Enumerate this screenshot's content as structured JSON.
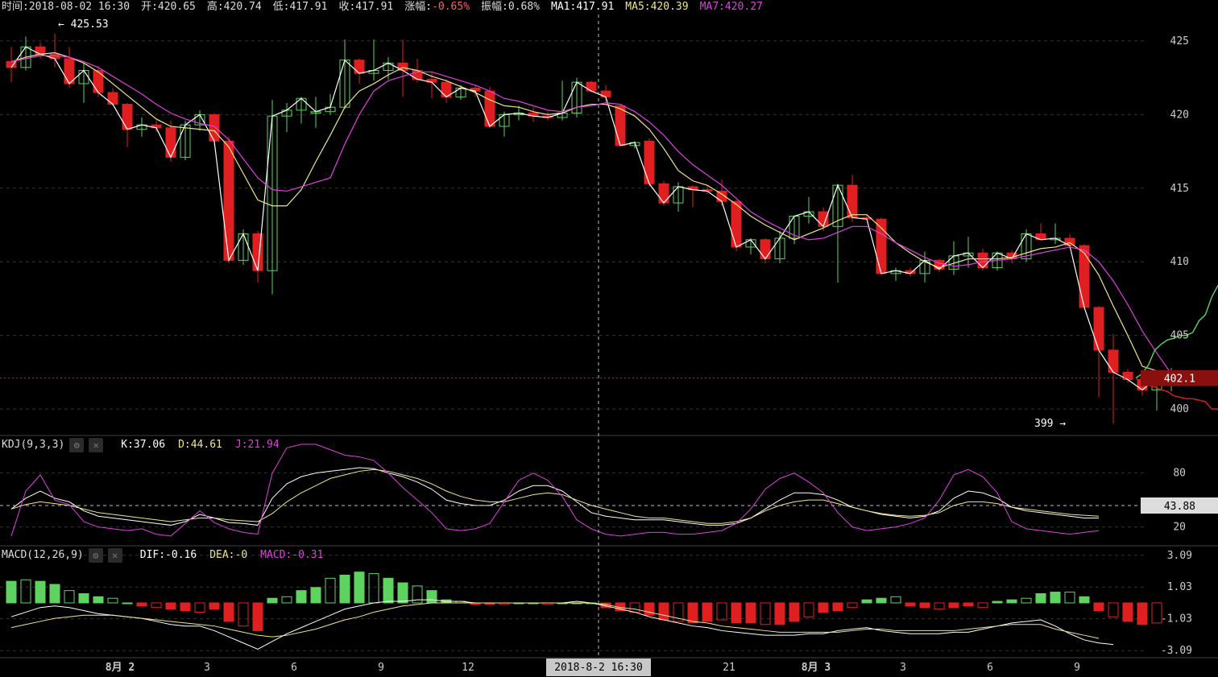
{
  "header": {
    "time_label": "时间:2018-08-02 16:30",
    "open_label": "开:420.65",
    "high_label": "高:420.74",
    "low_label": "低:417.91",
    "close_label": "收:417.91",
    "change_prefix": "涨幅:",
    "change_value": "-0.65%",
    "amplitude_label": "振幅:0.68%",
    "ma1_label": "MA1:417.91",
    "ma5_label": "MA5:420.39",
    "ma7_label": "MA7:420.27"
  },
  "kdj": {
    "title": "KDJ(9,3,3)",
    "k_label": "K:37.06",
    "d_label": "D:44.61",
    "j_label": "J:21.94"
  },
  "macd": {
    "title": "MACD(12,26,9)",
    "dif_label": "DIF:-0.16",
    "dea_label": "DEA:-0",
    "macd_label": "MACD:-0.31"
  },
  "colors": {
    "up": "#5fd35f",
    "down": "#e02020",
    "ma1": "#ffffff",
    "ma5": "#f0e68c",
    "ma7": "#e040e0",
    "change_text": "#ff6060",
    "grid": "#333333",
    "axis_text": "#cccccc"
  },
  "icons": {
    "settings": "gear-icon",
    "close": "close-icon"
  },
  "chart_data": {
    "type": "candlestick",
    "price_axis": {
      "ticks": [
        425,
        420,
        415,
        410,
        405,
        400
      ],
      "ylim": [
        398.2,
        426.8
      ]
    },
    "x_labels": [
      {
        "i": 7.5,
        "label": "8月 2",
        "bold": true
      },
      {
        "i": 13.5,
        "label": "3"
      },
      {
        "i": 19.5,
        "label": "6"
      },
      {
        "i": 25.5,
        "label": "9"
      },
      {
        "i": 31.5,
        "label": "12"
      },
      {
        "i": 49.5,
        "label": "21"
      },
      {
        "i": 55.5,
        "label": "8月 3",
        "bold": true
      },
      {
        "i": 61.5,
        "label": "3"
      },
      {
        "i": 67.5,
        "label": "6"
      },
      {
        "i": 73.5,
        "label": "9"
      }
    ],
    "crosshair": {
      "index": 40.5,
      "price": 402.1,
      "price_label": "402.1",
      "time_label": "2018-8-2 16:30"
    },
    "annotations": {
      "high_label": "← 425.53",
      "low_label": "399 →"
    },
    "candles": [
      {
        "o": 423.6,
        "h": 424.6,
        "l": 422.2,
        "c": 423.2
      },
      {
        "o": 423.2,
        "h": 425.3,
        "l": 423.0,
        "c": 424.6
      },
      {
        "o": 424.6,
        "h": 424.9,
        "l": 423.8,
        "c": 424.1
      },
      {
        "o": 424.1,
        "h": 425.5,
        "l": 423.2,
        "c": 423.8
      },
      {
        "o": 423.8,
        "h": 424.6,
        "l": 421.8,
        "c": 422.1
      },
      {
        "o": 422.1,
        "h": 423.5,
        "l": 420.8,
        "c": 423.0
      },
      {
        "o": 423.0,
        "h": 423.3,
        "l": 421.2,
        "c": 421.5
      },
      {
        "o": 421.5,
        "h": 421.8,
        "l": 420.6,
        "c": 420.7
      },
      {
        "o": 420.7,
        "h": 420.8,
        "l": 417.8,
        "c": 419.0
      },
      {
        "o": 419.0,
        "h": 419.8,
        "l": 418.5,
        "c": 419.3
      },
      {
        "o": 419.3,
        "h": 419.6,
        "l": 418.8,
        "c": 419.1
      },
      {
        "o": 419.1,
        "h": 419.6,
        "l": 416.8,
        "c": 417.1
      },
      {
        "o": 417.1,
        "h": 419.6,
        "l": 416.9,
        "c": 419.3
      },
      {
        "o": 419.3,
        "h": 420.3,
        "l": 418.9,
        "c": 420.0
      },
      {
        "o": 420.0,
        "h": 420.1,
        "l": 417.9,
        "c": 418.2
      },
      {
        "o": 418.2,
        "h": 418.5,
        "l": 409.9,
        "c": 410.1
      },
      {
        "o": 410.1,
        "h": 412.2,
        "l": 409.8,
        "c": 411.9
      },
      {
        "o": 411.9,
        "h": 412.1,
        "l": 408.6,
        "c": 409.4
      },
      {
        "o": 409.4,
        "h": 421.0,
        "l": 407.8,
        "c": 419.9
      },
      {
        "o": 419.9,
        "h": 420.8,
        "l": 418.8,
        "c": 420.3
      },
      {
        "o": 420.3,
        "h": 421.2,
        "l": 419.4,
        "c": 421.1
      },
      {
        "o": 420.1,
        "h": 421.2,
        "l": 419.1,
        "c": 420.2
      },
      {
        "o": 420.2,
        "h": 421.4,
        "l": 420.0,
        "c": 420.5
      },
      {
        "o": 420.5,
        "h": 425.1,
        "l": 420.4,
        "c": 423.7
      },
      {
        "o": 423.7,
        "h": 423.8,
        "l": 422.1,
        "c": 422.8
      },
      {
        "o": 422.8,
        "h": 425.1,
        "l": 422.3,
        "c": 423.0
      },
      {
        "o": 423.0,
        "h": 423.9,
        "l": 422.4,
        "c": 423.5
      },
      {
        "o": 423.5,
        "h": 425.1,
        "l": 421.2,
        "c": 423.0
      },
      {
        "o": 423.0,
        "h": 423.8,
        "l": 422.2,
        "c": 422.4
      },
      {
        "o": 422.4,
        "h": 422.9,
        "l": 421.1,
        "c": 422.2
      },
      {
        "o": 422.2,
        "h": 422.4,
        "l": 420.8,
        "c": 421.2
      },
      {
        "o": 421.2,
        "h": 422.0,
        "l": 421.0,
        "c": 421.8
      },
      {
        "o": 421.8,
        "h": 422.0,
        "l": 421.2,
        "c": 421.6
      },
      {
        "o": 421.6,
        "h": 421.9,
        "l": 419.1,
        "c": 419.2
      },
      {
        "o": 419.2,
        "h": 420.2,
        "l": 418.5,
        "c": 420.0
      },
      {
        "o": 420.0,
        "h": 420.6,
        "l": 419.6,
        "c": 420.1
      },
      {
        "o": 420.1,
        "h": 420.5,
        "l": 419.5,
        "c": 419.9
      },
      {
        "o": 419.9,
        "h": 420.2,
        "l": 419.6,
        "c": 419.8
      },
      {
        "o": 419.8,
        "h": 422.3,
        "l": 419.6,
        "c": 420.1
      },
      {
        "o": 420.1,
        "h": 422.5,
        "l": 419.8,
        "c": 422.2
      },
      {
        "o": 422.2,
        "h": 422.3,
        "l": 421.5,
        "c": 421.6
      },
      {
        "o": 421.6,
        "h": 422.0,
        "l": 420.6,
        "c": 421.2
      },
      {
        "o": 420.6,
        "h": 420.7,
        "l": 417.9,
        "c": 417.9
      },
      {
        "o": 417.9,
        "h": 418.2,
        "l": 417.7,
        "c": 418.1
      },
      {
        "o": 418.2,
        "h": 418.4,
        "l": 415.1,
        "c": 415.3
      },
      {
        "o": 415.3,
        "h": 415.5,
        "l": 413.8,
        "c": 414.0
      },
      {
        "o": 414.0,
        "h": 415.4,
        "l": 413.4,
        "c": 415.1
      },
      {
        "o": 415.1,
        "h": 415.2,
        "l": 413.7,
        "c": 414.9
      },
      {
        "o": 414.9,
        "h": 415.2,
        "l": 414.6,
        "c": 414.8
      },
      {
        "o": 414.8,
        "h": 415.6,
        "l": 413.8,
        "c": 414.1
      },
      {
        "o": 414.1,
        "h": 414.2,
        "l": 410.7,
        "c": 411.0
      },
      {
        "o": 411.0,
        "h": 411.6,
        "l": 410.5,
        "c": 411.5
      },
      {
        "o": 411.5,
        "h": 411.6,
        "l": 409.9,
        "c": 410.2
      },
      {
        "o": 410.2,
        "h": 412.1,
        "l": 409.9,
        "c": 411.6
      },
      {
        "o": 411.6,
        "h": 413.1,
        "l": 411.2,
        "c": 413.1
      },
      {
        "o": 413.1,
        "h": 414.4,
        "l": 412.6,
        "c": 413.4
      },
      {
        "o": 413.4,
        "h": 413.7,
        "l": 412.1,
        "c": 412.4
      },
      {
        "o": 412.4,
        "h": 415.3,
        "l": 408.6,
        "c": 415.2
      },
      {
        "o": 415.2,
        "h": 415.9,
        "l": 412.7,
        "c": 413.0
      },
      {
        "o": 413.0,
        "h": 413.2,
        "l": 412.9,
        "c": 412.9
      },
      {
        "o": 412.9,
        "h": 413.0,
        "l": 409.1,
        "c": 409.2
      },
      {
        "o": 409.2,
        "h": 409.6,
        "l": 408.7,
        "c": 409.4
      },
      {
        "o": 409.4,
        "h": 409.6,
        "l": 409.0,
        "c": 409.2
      },
      {
        "o": 409.2,
        "h": 410.7,
        "l": 408.6,
        "c": 410.1
      },
      {
        "o": 410.1,
        "h": 410.2,
        "l": 409.3,
        "c": 409.5
      },
      {
        "o": 409.5,
        "h": 411.4,
        "l": 409.1,
        "c": 410.4
      },
      {
        "o": 410.4,
        "h": 411.7,
        "l": 409.6,
        "c": 410.6
      },
      {
        "o": 410.6,
        "h": 410.9,
        "l": 409.4,
        "c": 409.6
      },
      {
        "o": 409.6,
        "h": 410.7,
        "l": 409.4,
        "c": 410.6
      },
      {
        "o": 410.6,
        "h": 410.8,
        "l": 409.9,
        "c": 410.2
      },
      {
        "o": 410.2,
        "h": 412.2,
        "l": 410.0,
        "c": 411.9
      },
      {
        "o": 411.9,
        "h": 412.6,
        "l": 411.6,
        "c": 411.5
      },
      {
        "o": 411.5,
        "h": 412.6,
        "l": 411.2,
        "c": 411.6
      },
      {
        "o": 411.6,
        "h": 411.9,
        "l": 410.9,
        "c": 411.1
      },
      {
        "o": 411.1,
        "h": 411.2,
        "l": 406.8,
        "c": 406.9
      },
      {
        "o": 406.9,
        "h": 407.0,
        "l": 400.8,
        "c": 404.0
      },
      {
        "o": 404.0,
        "h": 405.1,
        "l": 399.0,
        "c": 402.5
      },
      {
        "o": 402.5,
        "h": 402.7,
        "l": 401.8,
        "c": 402.0
      },
      {
        "o": 402.0,
        "h": 402.2,
        "l": 400.9,
        "c": 401.3
      },
      {
        "o": 401.3,
        "h": 402.6,
        "l": 399.9,
        "c": 402.1
      },
      {
        "o": 402.1,
        "h": 402.8,
        "l": 401.2,
        "c": 402.1
      }
    ],
    "ma5": [
      423.6,
      423.9,
      424.1,
      424.2,
      423.9,
      423.5,
      422.9,
      422.1,
      421.3,
      420.5,
      419.7,
      419.2,
      419.1,
      419.0,
      418.9,
      417.8,
      416.0,
      414.2,
      413.8,
      413.8,
      414.9,
      416.8,
      418.6,
      420.5,
      421.6,
      422.1,
      422.7,
      423.2,
      423.0,
      422.6,
      422.3,
      421.9,
      421.5,
      421.0,
      420.6,
      420.5,
      420.2,
      420.0,
      420.1,
      420.5,
      420.7,
      420.7,
      420.4,
      419.9,
      419.0,
      417.7,
      416.2,
      415.5,
      415.2,
      414.6,
      413.9,
      413.1,
      412.5,
      412.0,
      411.5,
      411.9,
      412.3,
      412.8,
      413.2,
      413.2,
      412.3,
      411.3,
      410.6,
      410.0,
      409.6,
      409.9,
      410.2,
      410.2,
      410.2,
      410.3,
      410.6,
      410.9,
      411.0,
      411.3,
      410.6,
      409.1,
      407.0,
      405.0,
      402.9,
      402.6,
      402.1
    ],
    "ma7": [
      423.6,
      423.8,
      424.0,
      424.0,
      423.9,
      423.6,
      423.2,
      422.6,
      422.0,
      421.4,
      420.7,
      420.1,
      419.7,
      419.4,
      419.2,
      418.3,
      417.0,
      415.7,
      414.9,
      414.8,
      415.1,
      415.4,
      415.7,
      418.0,
      420.0,
      421.6,
      422.3,
      422.6,
      422.9,
      422.9,
      422.6,
      422.3,
      422.0,
      421.6,
      421.1,
      420.9,
      420.6,
      420.3,
      420.2,
      420.5,
      420.6,
      420.8,
      420.7,
      420.2,
      419.5,
      418.6,
      417.5,
      416.6,
      415.9,
      415.2,
      414.3,
      413.4,
      412.8,
      412.3,
      411.8,
      411.5,
      411.6,
      412.0,
      412.4,
      412.4,
      411.9,
      411.3,
      410.8,
      410.3,
      409.9,
      409.7,
      409.8,
      410.0,
      410.1,
      410.2,
      410.4,
      410.6,
      410.8,
      411.0,
      410.8,
      410.0,
      408.7,
      407.1,
      405.3,
      403.8,
      402.4
    ],
    "kdj": {
      "ticks": [
        80,
        20
      ],
      "ylim": [
        0,
        120
      ],
      "crosshair_value": 43.88,
      "crosshair_label": "43.88",
      "K": [
        40,
        52,
        60,
        52,
        48,
        38,
        32,
        30,
        28,
        26,
        24,
        22,
        26,
        34,
        30,
        25,
        24,
        22,
        52,
        68,
        76,
        80,
        82,
        84,
        86,
        85,
        80,
        76,
        70,
        62,
        50,
        46,
        44,
        44,
        50,
        60,
        66,
        66,
        60,
        48,
        36,
        32,
        30,
        28,
        28,
        28,
        26,
        24,
        22,
        22,
        24,
        30,
        40,
        50,
        58,
        58,
        56,
        50,
        42,
        38,
        34,
        32,
        30,
        32,
        38,
        52,
        60,
        58,
        52,
        42,
        38,
        36,
        34,
        32,
        30,
        30
      ],
      "D": [
        40,
        45,
        48,
        46,
        44,
        40,
        36,
        34,
        32,
        30,
        28,
        26,
        28,
        30,
        30,
        28,
        27,
        26,
        35,
        48,
        58,
        66,
        74,
        78,
        82,
        84,
        82,
        78,
        74,
        68,
        60,
        54,
        50,
        48,
        48,
        52,
        56,
        58,
        56,
        50,
        44,
        40,
        36,
        32,
        30,
        30,
        28,
        26,
        24,
        24,
        26,
        30,
        38,
        44,
        48,
        50,
        50,
        46,
        42,
        38,
        35,
        33,
        32,
        33,
        36,
        44,
        48,
        48,
        46,
        42,
        40,
        38,
        36,
        34,
        33,
        32
      ],
      "J": [
        10,
        60,
        78,
        50,
        45,
        26,
        20,
        18,
        16,
        18,
        12,
        10,
        24,
        38,
        25,
        18,
        14,
        12,
        80,
        108,
        112,
        112,
        106,
        100,
        98,
        94,
        80,
        64,
        50,
        36,
        18,
        16,
        18,
        24,
        48,
        72,
        80,
        72,
        54,
        28,
        18,
        12,
        10,
        12,
        14,
        14,
        12,
        12,
        14,
        16,
        24,
        40,
        62,
        74,
        80,
        70,
        58,
        36,
        20,
        16,
        18,
        20,
        24,
        30,
        50,
        78,
        84,
        76,
        58,
        26,
        18,
        16,
        14,
        12,
        14,
        16
      ]
    },
    "macd": {
      "ticks": [
        3.09,
        1.03,
        -1.03,
        -3.09
      ],
      "ylim": [
        -3.5,
        3.6
      ],
      "dif": [
        -0.9,
        -0.6,
        -0.3,
        -0.2,
        -0.3,
        -0.5,
        -0.7,
        -0.8,
        -0.9,
        -1.0,
        -1.2,
        -1.4,
        -1.5,
        -1.5,
        -1.8,
        -2.2,
        -2.6,
        -3.0,
        -2.5,
        -2.0,
        -1.6,
        -1.2,
        -0.8,
        -0.4,
        -0.2,
        0.0,
        0.1,
        0.1,
        0.2,
        0.2,
        0.1,
        0.1,
        0.0,
        0.0,
        0.0,
        0.0,
        0.0,
        0.0,
        0.0,
        0.1,
        0.0,
        -0.2,
        -0.4,
        -0.6,
        -0.9,
        -1.1,
        -1.3,
        -1.5,
        -1.6,
        -1.8,
        -1.9,
        -2.0,
        -2.1,
        -2.1,
        -2.1,
        -2.0,
        -2.0,
        -1.8,
        -1.7,
        -1.6,
        -1.8,
        -1.9,
        -2.0,
        -2.0,
        -2.0,
        -1.9,
        -1.9,
        -1.7,
        -1.5,
        -1.3,
        -1.2,
        -1.1,
        -1.5,
        -2.0,
        -2.4,
        -2.6,
        -2.7
      ],
      "dea": [
        -1.6,
        -1.4,
        -1.2,
        -1.0,
        -0.9,
        -0.8,
        -0.8,
        -0.8,
        -0.9,
        -1.0,
        -1.1,
        -1.2,
        -1.3,
        -1.4,
        -1.5,
        -1.7,
        -1.9,
        -2.1,
        -2.2,
        -2.1,
        -1.9,
        -1.7,
        -1.4,
        -1.1,
        -0.9,
        -0.6,
        -0.4,
        -0.2,
        -0.1,
        0.0,
        0.0,
        0.0,
        0.0,
        0.0,
        0.0,
        0.0,
        0.0,
        0.0,
        0.0,
        0.0,
        0.0,
        -0.1,
        -0.3,
        -0.4,
        -0.6,
        -0.8,
        -1.0,
        -1.2,
        -1.3,
        -1.5,
        -1.6,
        -1.7,
        -1.8,
        -1.9,
        -1.9,
        -1.9,
        -1.9,
        -1.9,
        -1.8,
        -1.7,
        -1.7,
        -1.8,
        -1.8,
        -1.8,
        -1.8,
        -1.8,
        -1.7,
        -1.6,
        -1.5,
        -1.4,
        -1.4,
        -1.4,
        -1.7,
        -1.9,
        -2.1,
        -2.3
      ],
      "hist": [
        1.4,
        1.5,
        1.4,
        1.2,
        0.8,
        0.6,
        0.4,
        0.3,
        0.0,
        -0.2,
        -0.3,
        -0.4,
        -0.5,
        -0.6,
        -0.4,
        -1.2,
        -1.5,
        -1.8,
        0.3,
        0.4,
        0.8,
        1.0,
        1.6,
        1.8,
        2.0,
        1.9,
        1.6,
        1.3,
        1.1,
        0.8,
        0.2,
        0.1,
        -0.1,
        -0.1,
        -0.1,
        0.0,
        0.0,
        -0.1,
        0.0,
        0.0,
        0.0,
        -0.3,
        -0.5,
        -0.6,
        -0.8,
        -1.1,
        -1.2,
        -1.3,
        -1.2,
        -1.1,
        -1.3,
        -1.3,
        -1.4,
        -1.4,
        -1.2,
        -0.9,
        -0.6,
        -0.5,
        -0.3,
        0.2,
        0.3,
        0.4,
        -0.2,
        -0.3,
        -0.4,
        -0.3,
        -0.2,
        -0.3,
        0.1,
        0.2,
        0.3,
        0.6,
        0.7,
        0.7,
        0.4,
        -0.5,
        -0.9,
        -1.2,
        -1.4,
        -1.3
      ]
    },
    "depth": {
      "bids_price_path": [
        402.1,
        402.4,
        403.0,
        404.0,
        404.4,
        404.7,
        404.8,
        405.0,
        405.0,
        405.2,
        406.0,
        406.4,
        407.6,
        408.4
      ],
      "asks_price_path": [
        402.1,
        401.8,
        401.6,
        401.5,
        401.3,
        401.2,
        400.9,
        400.8,
        400.7,
        400.7,
        400.6,
        400.5,
        400.0,
        400.0
      ]
    }
  }
}
